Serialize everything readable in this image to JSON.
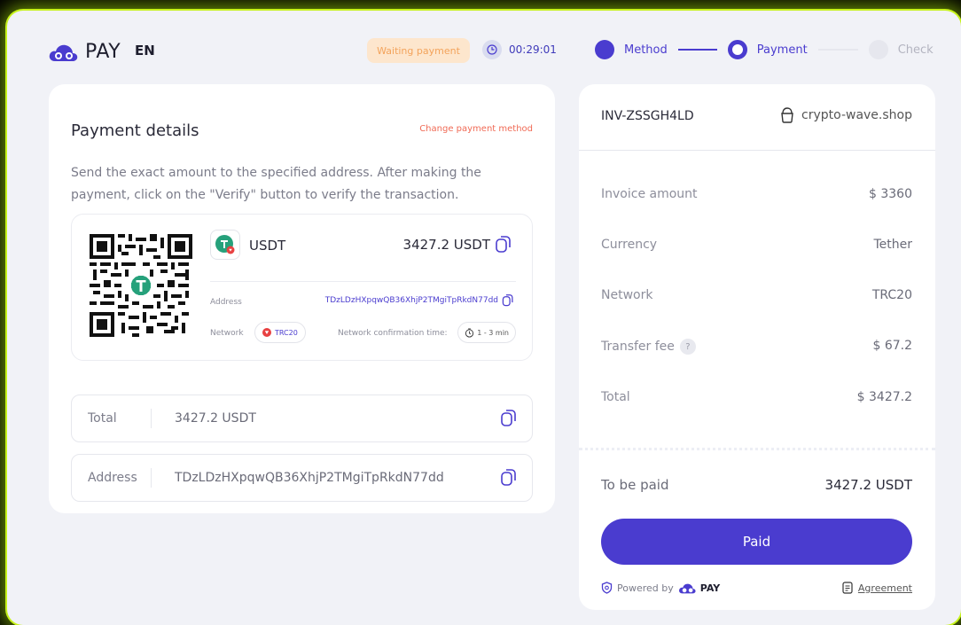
{
  "header": {
    "logo_text": "PAY",
    "language": "EN",
    "status": "Waiting payment",
    "timer": "00:29:01",
    "steps": [
      {
        "label": "Method"
      },
      {
        "label": "Payment"
      },
      {
        "label": "Check"
      }
    ]
  },
  "details": {
    "title": "Payment details",
    "change_link": "Change payment method",
    "description": "Send the exact amount to the specified address. After making the payment, click on the \"Verify\" button to verify the transaction.",
    "coin": "USDT",
    "amount": "3427.2 USDT",
    "address_label": "Address",
    "address": "TDzLDzHXpqwQB36XhjP2TMgiTpRkdN77dd",
    "network_label": "Network",
    "network": "TRC20",
    "confirmation_label": "Network confirmation time:",
    "confirmation_time": "1 - 3 min",
    "total_label": "Total",
    "total_value": "3427.2 USDT",
    "field_address_label": "Address",
    "field_address_value": "TDzLDzHXpqwQB36XhjP2TMgiTpRkdN77dd"
  },
  "invoice": {
    "id": "INV-ZSSGH4LD",
    "shop": "crypto-wave.shop",
    "rows": [
      {
        "label": "Invoice amount",
        "value": "$ 3360"
      },
      {
        "label": "Currency",
        "value": "Tether"
      },
      {
        "label": "Network",
        "value": "TRC20"
      },
      {
        "label": "Transfer fee",
        "value": "$ 67.2"
      },
      {
        "label": "Total",
        "value": "$ 3427.2"
      }
    ],
    "help_mark": "?",
    "to_be_paid_label": "To be paid",
    "to_be_paid_value": "3427.2 USDT",
    "paid_button": "Paid",
    "powered_by": "Powered by",
    "powered_brand": "PAY",
    "agreement": "Agreement"
  },
  "colors": {
    "accent": "#4a3ccf",
    "status_bg": "#fde6cd",
    "status_text": "#f3a35b",
    "link_red": "#f06a55",
    "glow": "#c6f21a",
    "tether_green": "#26a17b"
  },
  "icons": [
    "cloud-logo-icon",
    "clock-icon",
    "tether-icon",
    "copy-icon",
    "timer-icon",
    "bag-icon",
    "shield-icon",
    "document-icon"
  ]
}
